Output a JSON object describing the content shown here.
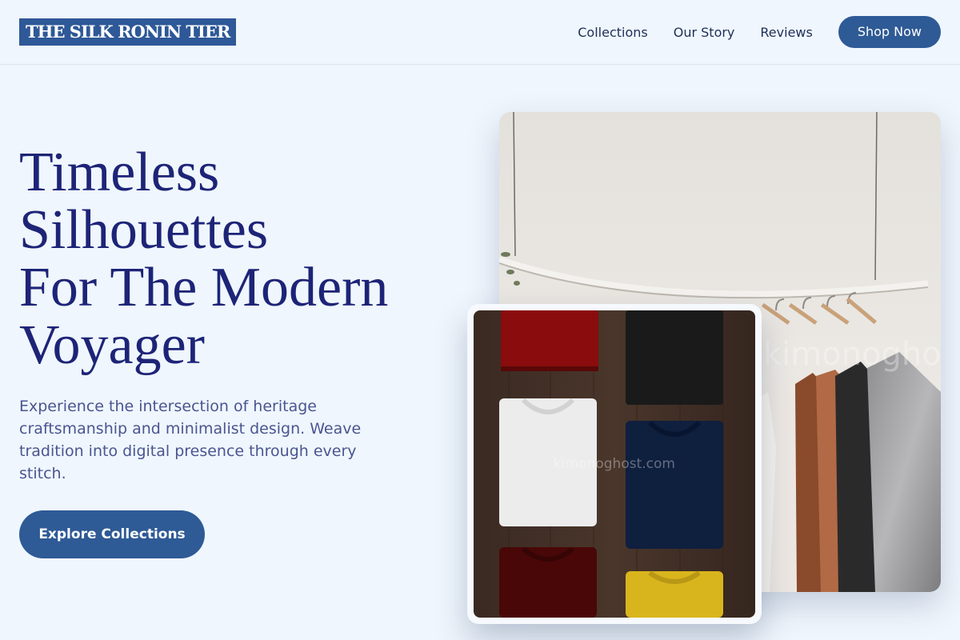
{
  "brand": {
    "logo_text": "THE SILK RONIN TIER"
  },
  "nav": {
    "links": [
      "Collections",
      "Our Story",
      "Reviews"
    ],
    "cta_label": "Shop Now"
  },
  "hero": {
    "title_lines": [
      "Timeless",
      "Silhouettes",
      "For The Modern",
      "Voyager"
    ],
    "description": "Experience the intersection of heritage craftsmanship and minimalist design. Weave tradition into digital presence through every stitch.",
    "cta_label": "Explore Collections"
  },
  "images": {
    "rack_watermark": "kimonoghost.com",
    "shirts_watermark": "kimonoghost.com"
  },
  "colors": {
    "page_bg": "#eff6fd",
    "brand_blue": "#2e5a96",
    "title_navy": "#1d2477",
    "body_text": "#4a5591"
  }
}
